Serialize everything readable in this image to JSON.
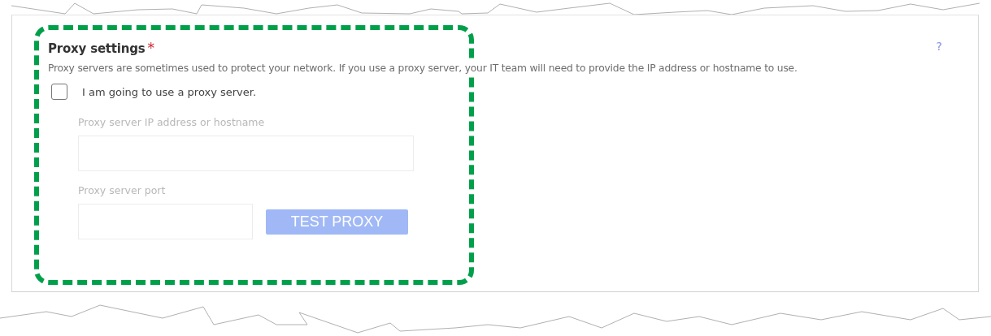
{
  "section": {
    "title": "Proxy settings",
    "required_mark": "*",
    "help": "?",
    "description": "Proxy servers are sometimes used to protect your network. If you use a proxy server, your IT team will need to provide the IP address or hostname to use."
  },
  "checkbox": {
    "label": "I am going to use a proxy server.",
    "checked": false
  },
  "fields": [
    {
      "label": "Proxy server IP address or hostname",
      "kind": "wide",
      "disabled": true
    },
    {
      "label": "Proxy server port",
      "kind": "narrow",
      "disabled": true
    }
  ],
  "button": {
    "label": "TEST PROXY",
    "disabled": true
  }
}
